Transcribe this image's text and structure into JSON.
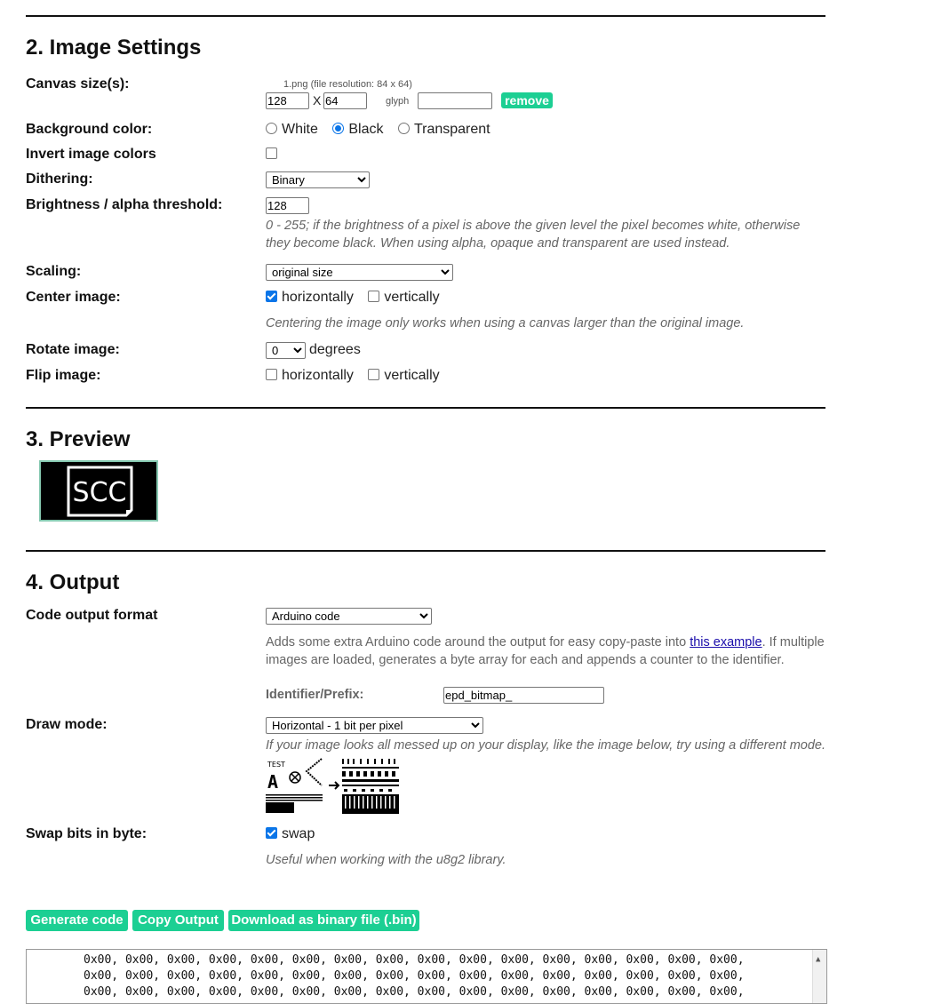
{
  "image_settings": {
    "heading": "2. Image Settings",
    "canvas": {
      "label": "Canvas size(s):",
      "file_info": "1.png (file resolution: 84 x 64)",
      "width": "128",
      "x_sep": "X",
      "height": "64",
      "glyph_label": "glyph",
      "glyph_value": "",
      "remove_label": "remove"
    },
    "background": {
      "label": "Background color:",
      "options": [
        "White",
        "Black",
        "Transparent"
      ],
      "selected": "Black"
    },
    "invert": {
      "label": "Invert image colors",
      "checked": false
    },
    "dithering": {
      "label": "Dithering:",
      "value": "Binary"
    },
    "threshold": {
      "label": "Brightness / alpha threshold:",
      "value": "128",
      "hint": "0 - 255; if the brightness of a pixel is above the given level the pixel becomes white, otherwise they become black. When using alpha, opaque and transparent are used instead."
    },
    "scaling": {
      "label": "Scaling:",
      "value": "original size"
    },
    "center": {
      "label": "Center image:",
      "horizontal_label": "horizontally",
      "horizontal_checked": true,
      "vertical_label": "vertically",
      "vertical_checked": false,
      "hint": "Centering the image only works when using a canvas larger than the original image."
    },
    "rotate": {
      "label": "Rotate image:",
      "value": "0",
      "unit": "degrees"
    },
    "flip": {
      "label": "Flip image:",
      "horizontal_label": "horizontally",
      "horizontal_checked": false,
      "vertical_label": "vertically",
      "vertical_checked": false
    }
  },
  "preview": {
    "heading": "3. Preview",
    "image_text": "SCC",
    "frame_color": "#86c9b1"
  },
  "output": {
    "heading": "4. Output",
    "format": {
      "label": "Code output format",
      "value": "Arduino code",
      "desc_before": "Adds some extra Arduino code around the output for easy copy-paste into ",
      "desc_link": "this example",
      "desc_after": ". If multiple images are loaded, generates a byte array for each and appends a counter to the identifier."
    },
    "identifier": {
      "label": "Identifier/Prefix:",
      "value": "epd_bitmap_"
    },
    "draw_mode": {
      "label": "Draw mode:",
      "value": "Horizontal - 1 bit per pixel",
      "hint": "If your image looks all messed up on your display, like the image below, try using a different mode.",
      "example_text": "TEST"
    },
    "swap": {
      "label": "Swap bits in byte:",
      "option_label": "swap",
      "checked": true,
      "hint": "Useful when working with the u8g2 library."
    },
    "buttons": {
      "generate": "Generate code",
      "copy": "Copy Output",
      "download": "Download as binary file (.bin)"
    },
    "code_lines": [
      "0x00, 0x00, 0x00, 0x00, 0x00, 0x00, 0x00, 0x00, 0x00, 0x00, 0x00, 0x00, 0x00, 0x00, 0x00, 0x00,",
      "0x00, 0x00, 0x00, 0x00, 0x00, 0x00, 0x00, 0x00, 0x00, 0x00, 0x00, 0x00, 0x00, 0x00, 0x00, 0x00,",
      "0x00, 0x00, 0x00, 0x00, 0x00, 0x00, 0x00, 0x00, 0x00, 0x00, 0x00, 0x00, 0x00, 0x00, 0x00, 0x00,"
    ]
  },
  "colors": {
    "accent_button": "#1ccf93",
    "checkbox_blue": "#0a75e8",
    "rule": "#111111"
  }
}
